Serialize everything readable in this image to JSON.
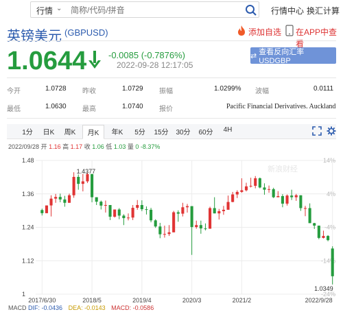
{
  "topbar": {
    "search_type": "行情",
    "search_placeholder": "简称/代码/拼音",
    "market_center": "行情中心",
    "fx_calculator": "换汇计算"
  },
  "header": {
    "title": "英镑美元",
    "code": "(GBPUSD)",
    "favorite": "添加自选",
    "app_view": "在APP中查看"
  },
  "quote": {
    "price": "1.0644",
    "change": "-0.0085 (-0.7876%)",
    "time": "2022-09-28 12:17:05",
    "reverse_button": "查看反向汇率 USDGBP"
  },
  "stats": {
    "open_label": "今开",
    "open": "1.0728",
    "prev_close_label": "昨收",
    "prev_close": "1.0729",
    "amplitude_label": "振幅",
    "amplitude": "1.0299%",
    "volatility_label": "波幅",
    "volatility": "0.0111",
    "low_label": "最低",
    "low": "1.0630",
    "high_label": "最高",
    "high": "1.0740",
    "quote_label": "报价",
    "quote_source": "Pacific Financial Derivatives. Auckland"
  },
  "tabs": [
    "1分",
    "日K",
    "周K",
    "月K",
    "年K",
    "5分",
    "15分",
    "30分",
    "60分",
    "4H"
  ],
  "active_tab": "月K",
  "ohlc": {
    "date": "2022/09/28",
    "open_label": "开",
    "open": "1.16",
    "high_label": "高",
    "high": "1.17",
    "close_label": "收",
    "close": "1.06",
    "low_label": "低",
    "low": "1.03",
    "amp_label": "量",
    "amp": "0 -8.37%"
  },
  "watermark": "新浪财经",
  "chart_data": {
    "type": "candlestick",
    "x_tick_labels": [
      "2017/6/30",
      "2018/5",
      "2019/4",
      "2020/3",
      "2021/2",
      "2022/9/28"
    ],
    "y_ticks_left": [
      "1.48",
      "1.36",
      "1.24",
      "1.12",
      "1"
    ],
    "y_ticks_right": [
      "14%",
      "4%",
      "-4%",
      "-14%",
      "-24%"
    ],
    "ylim": [
      1.0,
      1.48
    ],
    "max_label": "1.4377",
    "min_label": "1.0349",
    "candles": [
      [
        1.302,
        1.307,
        1.2825,
        1.2907
      ],
      [
        1.2907,
        1.315,
        1.293,
        1.3185
      ],
      [
        1.3185,
        1.355,
        1.279,
        1.343
      ],
      [
        1.343,
        1.36,
        1.328,
        1.349
      ],
      [
        1.349,
        1.361,
        1.33,
        1.34
      ],
      [
        1.34,
        1.353,
        1.314,
        1.328
      ],
      [
        1.328,
        1.361,
        1.333,
        1.355
      ],
      [
        1.355,
        1.4377,
        1.346,
        1.421
      ],
      [
        1.421,
        1.43,
        1.375,
        1.396
      ],
      [
        1.396,
        1.432,
        1.369,
        1.405
      ],
      [
        1.405,
        1.437,
        1.399,
        1.431
      ],
      [
        1.431,
        1.432,
        1.33,
        1.348
      ],
      [
        1.348,
        1.347,
        1.32,
        1.332
      ],
      [
        1.332,
        1.336,
        1.304,
        1.318
      ],
      [
        1.318,
        1.336,
        1.293,
        1.32
      ],
      [
        1.32,
        1.317,
        1.266,
        1.278
      ],
      [
        1.278,
        1.298,
        1.275,
        1.304
      ],
      [
        1.304,
        1.309,
        1.269,
        1.282
      ],
      [
        1.282,
        1.287,
        1.248,
        1.273
      ],
      [
        1.273,
        1.29,
        1.265,
        1.275
      ],
      [
        1.275,
        1.32,
        1.266,
        1.31
      ],
      [
        1.31,
        1.338,
        1.303,
        1.32
      ],
      [
        1.32,
        1.337,
        1.298,
        1.305
      ],
      [
        1.305,
        1.315,
        1.286,
        1.303
      ],
      [
        1.303,
        1.31,
        1.258,
        1.265
      ],
      [
        1.265,
        1.269,
        1.238,
        1.243
      ],
      [
        1.243,
        1.256,
        1.201,
        1.215
      ],
      [
        1.215,
        1.246,
        1.203,
        1.216
      ],
      [
        1.216,
        1.248,
        1.209,
        1.222
      ],
      [
        1.222,
        1.299,
        1.226,
        1.294
      ],
      [
        1.294,
        1.301,
        1.26,
        1.289
      ],
      [
        1.289,
        1.328,
        1.279,
        1.312
      ],
      [
        1.312,
        1.324,
        1.293,
        1.316
      ],
      [
        1.316,
        1.315,
        1.141,
        1.241
      ],
      [
        1.241,
        1.264,
        1.235,
        1.248
      ],
      [
        1.248,
        1.264,
        1.217,
        1.236
      ],
      [
        1.236,
        1.254,
        1.229,
        1.235
      ],
      [
        1.235,
        1.314,
        1.248,
        1.309
      ],
      [
        1.309,
        1.348,
        1.292,
        1.29
      ],
      [
        1.29,
        1.306,
        1.268,
        1.298
      ],
      [
        1.298,
        1.317,
        1.285,
        1.303
      ],
      [
        1.303,
        1.354,
        1.305,
        1.331
      ],
      [
        1.331,
        1.367,
        1.33,
        1.358
      ],
      [
        1.358,
        1.373,
        1.345,
        1.367
      ],
      [
        1.367,
        1.416,
        1.364,
        1.373
      ],
      [
        1.373,
        1.4,
        1.369,
        1.387
      ],
      [
        1.387,
        1.418,
        1.383,
        1.389
      ],
      [
        1.389,
        1.424,
        1.38,
        1.416
      ],
      [
        1.416,
        1.419,
        1.38,
        1.383
      ],
      [
        1.383,
        1.398,
        1.357,
        1.375
      ],
      [
        1.375,
        1.39,
        1.364,
        1.377
      ],
      [
        1.377,
        1.382,
        1.345,
        1.348
      ],
      [
        1.348,
        1.37,
        1.349,
        1.352
      ],
      [
        1.352,
        1.359,
        1.312,
        1.325
      ],
      [
        1.325,
        1.358,
        1.318,
        1.354
      ],
      [
        1.354,
        1.375,
        1.338,
        1.348
      ],
      [
        1.348,
        1.36,
        1.335,
        1.355
      ],
      [
        1.355,
        1.33,
        1.299,
        1.309
      ],
      [
        1.309,
        1.317,
        1.28,
        1.309
      ],
      [
        1.309,
        1.326,
        1.292,
        1.255
      ],
      [
        1.255,
        1.256,
        1.234,
        1.246
      ],
      [
        1.246,
        1.212,
        1.197,
        1.202
      ],
      [
        1.202,
        1.228,
        1.2,
        1.209
      ],
      [
        1.209,
        1.212,
        1.19,
        1.194
      ],
      [
        1.164,
        1.172,
        1.0349,
        1.0644
      ]
    ],
    "macd": {
      "dif_label": "DIF:",
      "dif": "-0.0436",
      "dea_label": "DEA:",
      "dea": "-0.0143",
      "macd_label": "MACD:",
      "macd": "-0.0586"
    },
    "colors": {
      "up": "#e03434",
      "down": "#259c3e",
      "grid": "#ececec"
    }
  }
}
